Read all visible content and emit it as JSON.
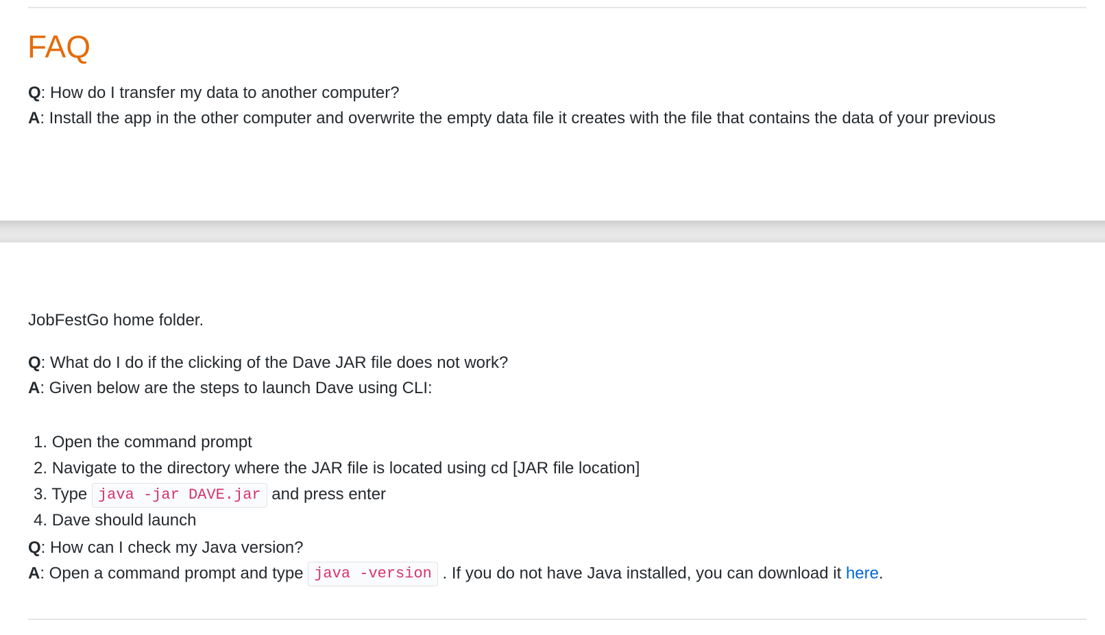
{
  "faq": {
    "title": "FAQ",
    "q_prefix": "Q",
    "a_prefix": "A",
    "items": [
      {
        "question": ": How do I transfer my data to another computer?",
        "answer": ": Install the app in the other computer and overwrite the empty data file it creates with the file that contains the data of your previous",
        "answer_continued": "JobFestGo home folder."
      },
      {
        "question": ": What do I do if the clicking of the Dave JAR file does not work?",
        "answer": ": Given below are the steps to launch Dave using CLI:",
        "steps": [
          {
            "num": "1.",
            "text": "Open the command prompt"
          },
          {
            "num": "2.",
            "text": "Navigate to the directory where the JAR file is located using cd [JAR file location]"
          },
          {
            "num": "3.",
            "pre": "Type",
            "code": "java -jar DAVE.jar",
            "post": "and press enter"
          },
          {
            "num": "4.",
            "text": "Dave should launch"
          }
        ]
      },
      {
        "question": ": How can I check my Java version?",
        "answer_pre": ": Open a command prompt and type",
        "answer_code": "java -version",
        "answer_post": ". If you do not have Java installed, you can download it",
        "answer_link": "here",
        "answer_end": "."
      }
    ]
  },
  "colors": {
    "title": "#e46c0a",
    "code": "#d6336c",
    "link": "#0366d6",
    "text": "#24292e"
  }
}
